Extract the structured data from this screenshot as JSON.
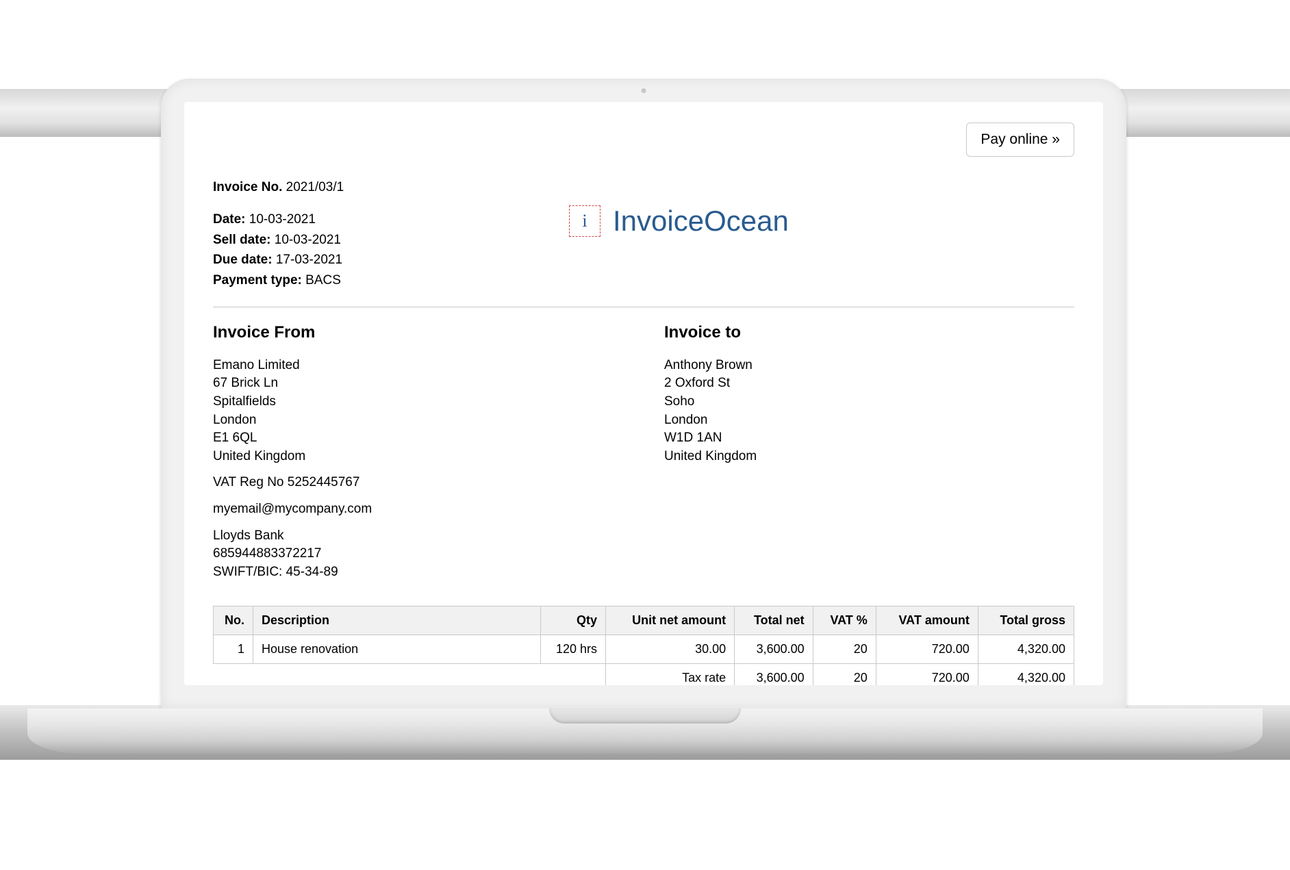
{
  "pay_button": "Pay online »",
  "invoice": {
    "number_label": "Invoice No.",
    "number": "2021/03/1",
    "date_label": "Date:",
    "date": "10-03-2021",
    "sell_date_label": "Sell date:",
    "sell_date": "10-03-2021",
    "due_date_label": "Due date:",
    "due_date": "17-03-2021",
    "payment_type_label": "Payment type:",
    "payment_type": "BACS"
  },
  "brand": {
    "icon_letter": "i",
    "name": "InvoiceOcean"
  },
  "from": {
    "heading": "Invoice From",
    "company": "Emano Limited",
    "line1": "67 Brick Ln",
    "line2": "Spitalfields",
    "city": "London",
    "postcode": "E1 6QL",
    "country": "United Kingdom",
    "vat": "VAT Reg No 5252445767",
    "email": "myemail@mycompany.com",
    "bank": "Lloyds Bank",
    "account": "685944883372217",
    "swift": "SWIFT/BIC: 45-34-89"
  },
  "to": {
    "heading": "Invoice to",
    "name": "Anthony Brown",
    "line1": "2 Oxford St",
    "line2": "Soho",
    "city": "London",
    "postcode": "W1D 1AN",
    "country": "United Kingdom"
  },
  "table": {
    "headers": {
      "no": "No.",
      "desc": "Description",
      "qty": "Qty",
      "unit": "Unit net amount",
      "total_net": "Total net",
      "vat_pct": "VAT %",
      "vat_amt": "VAT amount",
      "total_gross": "Total gross"
    },
    "rows": [
      {
        "no": "1",
        "desc": "House renovation",
        "qty": "120 hrs",
        "unit": "30.00",
        "total_net": "3,600.00",
        "vat_pct": "20",
        "vat_amt": "720.00",
        "total_gross": "4,320.00"
      }
    ],
    "tax_row": {
      "label": "Tax rate",
      "total_net": "3,600.00",
      "vat_pct": "20",
      "vat_amt": "720.00",
      "total_gross": "4,320.00"
    }
  }
}
